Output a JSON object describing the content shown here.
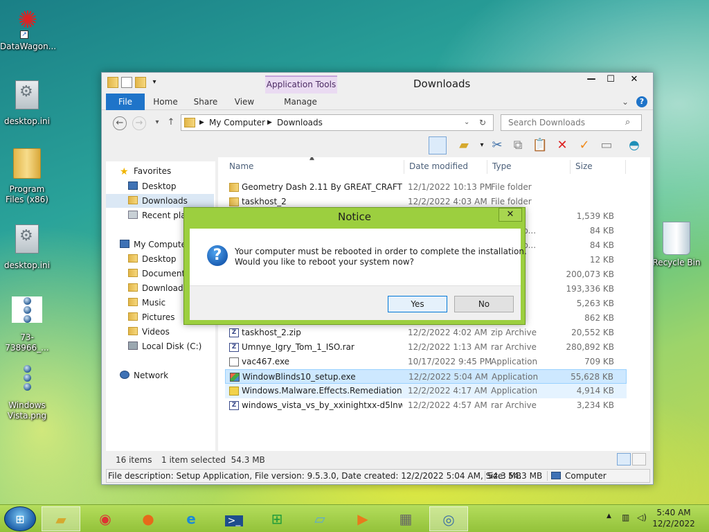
{
  "desktop": {
    "icons": [
      {
        "label": "DataWagon..."
      },
      {
        "label": "desktop.ini"
      },
      {
        "label": "Program Files (x86)"
      },
      {
        "label": "desktop.ini"
      },
      {
        "label": "73-738966_..."
      },
      {
        "label": "Windows Vista.png"
      },
      {
        "label": "Recycle Bin"
      }
    ]
  },
  "window": {
    "title": "Downloads",
    "context_tab": "Application Tools",
    "buttons": {
      "minimize": "—",
      "maximize": "☐",
      "close": "✕"
    },
    "ribbon_tabs": [
      "File",
      "Home",
      "Share",
      "View",
      "Manage"
    ],
    "address": {
      "crumbs": [
        "My Computer",
        "Downloads"
      ]
    },
    "search": {
      "placeholder": "Search Downloads"
    },
    "help": "?"
  },
  "nav": {
    "favorites": "Favorites",
    "fav_items": [
      "Desktop",
      "Downloads",
      "Recent plac"
    ],
    "computer": "My Compute",
    "comp_items": [
      "Desktop",
      "Documents",
      "Downloads",
      "Music",
      "Pictures",
      "Videos",
      "Local Disk (C:)"
    ],
    "network": "Network"
  },
  "columns": {
    "name": "Name",
    "date": "Date modified",
    "type": "Type",
    "size": "Size"
  },
  "files": [
    {
      "name": "Geometry Dash 2.11 By GREAT_CRAFTER",
      "date": "12/1/2022 10:13 PM",
      "type": "File folder",
      "size": "",
      "icon": "folder"
    },
    {
      "name": "taskhost_2",
      "date": "12/2/2022 4:03 AM",
      "type": "File folder",
      "size": "",
      "icon": "folder"
    },
    {
      "name": "",
      "date": "",
      "type": "on",
      "size": "1,539 KB",
      "icon": "none"
    },
    {
      "name": "",
      "date": "",
      "type": "HTML Do...",
      "size": "84 KB",
      "icon": "none"
    },
    {
      "name": "",
      "date": "",
      "type": "HTML Do...",
      "size": "84 KB",
      "icon": "none"
    },
    {
      "name": "",
      "date": "",
      "type": "ge",
      "size": "12 KB",
      "icon": "none"
    },
    {
      "name": "",
      "date": "",
      "type": "e",
      "size": "200,073 KB",
      "icon": "none"
    },
    {
      "name": "",
      "date": "",
      "type": "e",
      "size": "193,336 KB",
      "icon": "none"
    },
    {
      "name": "",
      "date": "",
      "type": "",
      "size": "5,263 KB",
      "icon": "none"
    },
    {
      "name": "",
      "date": "",
      "type": "e",
      "size": "862 KB",
      "icon": "none"
    },
    {
      "name": "taskhost_2.zip",
      "date": "12/2/2022 4:02 AM",
      "type": "zip Archive",
      "size": "20,552 KB",
      "icon": "zip"
    },
    {
      "name": "Umnye_Igry_Tom_1_ISO.rar",
      "date": "12/2/2022 1:13 AM",
      "type": "rar Archive",
      "size": "280,892 KB",
      "icon": "zip"
    },
    {
      "name": "vac467.exe",
      "date": "10/17/2022 9:45 PM",
      "type": "Application",
      "size": "709 KB",
      "icon": "exe"
    },
    {
      "name": "WindowBlinds10_setup.exe",
      "date": "12/2/2022 5:04 AM",
      "type": "Application",
      "size": "55,628 KB",
      "icon": "setup"
    },
    {
      "name": "Windows.Malware.Effects.Remediation.T...",
      "date": "12/2/2022 4:17 AM",
      "type": "Application",
      "size": "4,914 KB",
      "icon": "yellow"
    },
    {
      "name": "windows_vista_vs_by_xxinightxx-d5lnwve...",
      "date": "12/2/2022 4:57 AM",
      "type": "rar Archive",
      "size": "3,234 KB",
      "icon": "zip"
    }
  ],
  "status": {
    "count": "16 items",
    "selected": "1 item selected  54.3 MB"
  },
  "descbar": {
    "description": "File description: Setup Application, File version: 9.5.3.0, Date created: 12/2/2022 5:04 AM, Size: 54.3 MB",
    "size": "54.3 MB",
    "location": "Computer"
  },
  "dialog": {
    "title": "Notice",
    "close": "✕",
    "line1": "Your computer must be rebooted in order to complete the installation.",
    "line2": "Would you like to reboot your system now?",
    "yes": "Yes",
    "no": "No"
  },
  "taskbar": {
    "time": "5:40 AM",
    "date": "12/2/2022"
  }
}
